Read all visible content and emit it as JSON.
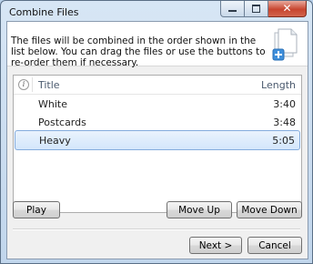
{
  "window": {
    "title": "Combine Files",
    "close_symbol": "✕",
    "caption_buttons": [
      "minimize-icon",
      "maximize-icon",
      "close-icon"
    ]
  },
  "header": {
    "description": "The files will be combined in the order shown in the list below. You can drag the files or use the buttons to re-order them if necessary.",
    "icon": "document-add-icon"
  },
  "list": {
    "info_symbol": "i",
    "columns": {
      "title": "Title",
      "length": "Length"
    },
    "rows": [
      {
        "title": "White",
        "length": "3:40",
        "selected": false
      },
      {
        "title": "Postcards",
        "length": "3:48",
        "selected": false
      },
      {
        "title": "Heavy",
        "length": "5:05",
        "selected": true
      }
    ]
  },
  "buttons": {
    "play": "Play",
    "move_up": "Move Up",
    "move_down": "Move Down",
    "next": "Next >",
    "cancel": "Cancel"
  },
  "colors": {
    "selection": "#d3e6fb",
    "selection_border": "#84acdd",
    "close_button": "#c7452f",
    "frame": "#c1d6ec"
  }
}
